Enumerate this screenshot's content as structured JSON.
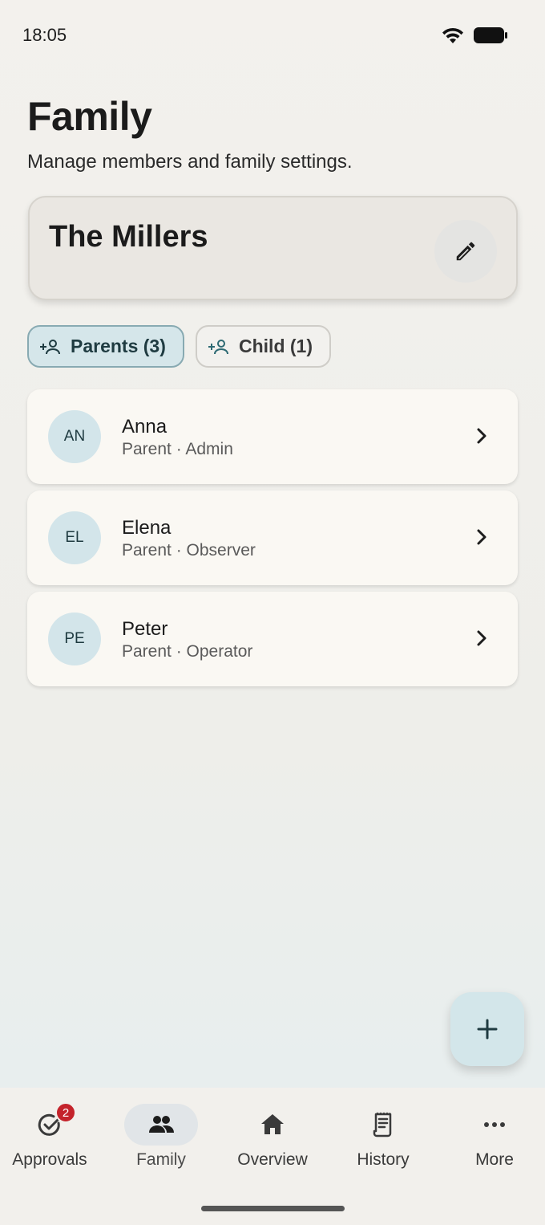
{
  "status": {
    "time": "18:05"
  },
  "header": {
    "title": "Family",
    "subtitle": "Manage members and family settings."
  },
  "family": {
    "name": "The Millers"
  },
  "filters": [
    {
      "label": "Parents (3)",
      "active": true
    },
    {
      "label": "Child (1)",
      "active": false
    }
  ],
  "members": [
    {
      "initials": "AN",
      "name": "Anna",
      "role": "Parent · Admin"
    },
    {
      "initials": "EL",
      "name": "Elena",
      "role": "Parent · Observer"
    },
    {
      "initials": "PE",
      "name": "Peter",
      "role": "Parent · Operator"
    }
  ],
  "nav": {
    "items": [
      {
        "label": "Approvals",
        "icon": "approvals-icon",
        "badge": "2"
      },
      {
        "label": "Family",
        "icon": "family-icon",
        "active": true
      },
      {
        "label": "Overview",
        "icon": "home-icon"
      },
      {
        "label": "History",
        "icon": "receipt-icon"
      },
      {
        "label": "More",
        "icon": "more-icon"
      }
    ]
  },
  "colors": {
    "accent": "#d3e6ea",
    "badge": "#c4232b"
  }
}
